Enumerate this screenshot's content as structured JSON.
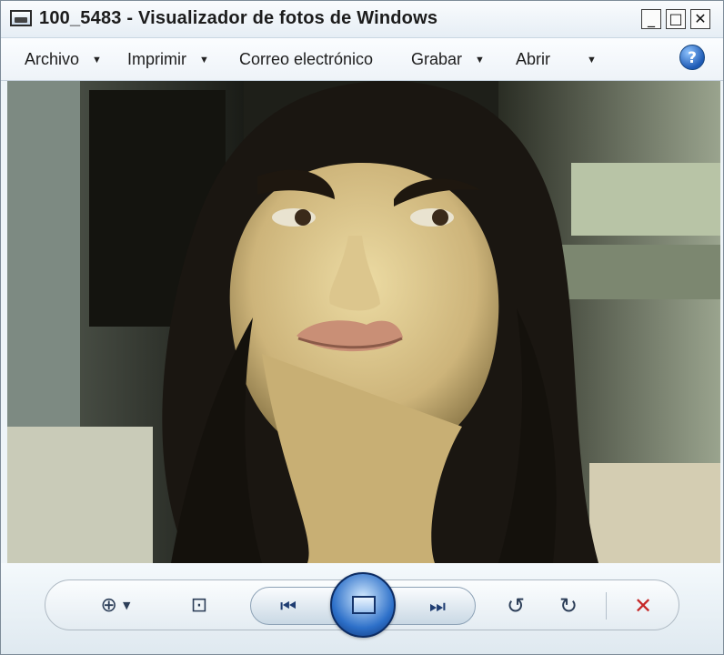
{
  "window": {
    "title": "100_5483 - Visualizador de fotos de Windows",
    "controls": {
      "minimize": "_",
      "maximize": "□",
      "close": "✕"
    }
  },
  "menubar": {
    "items": [
      {
        "label": "Archivo",
        "arrow": "▼"
      },
      {
        "label": "Imprimir",
        "arrow": "▼"
      },
      {
        "label": "Correo electrónico",
        "arrow": ""
      },
      {
        "label": "Grabar",
        "arrow": "▼"
      },
      {
        "label": "Abrir",
        "arrow": "▼"
      }
    ],
    "help_glyph": "?"
  },
  "toolbar": {
    "zoom_glyph": "⊕",
    "zoom_caret": "▼",
    "fit_glyph": "⊡",
    "prev_glyph": "⏮",
    "next_glyph": "⏭",
    "rotate_left_glyph": "↺",
    "rotate_right_glyph": "↻",
    "delete_glyph": "✕"
  },
  "icons": [
    "photo-viewer-app-icon",
    "help-icon",
    "zoom-icon",
    "fit-window-icon",
    "previous-icon",
    "slideshow-icon",
    "next-icon",
    "rotate-left-icon",
    "rotate-right-icon",
    "delete-icon"
  ],
  "colors": {
    "chrome": "#eef4f8",
    "accent": "#2d70c9",
    "delete": "#c62828"
  }
}
